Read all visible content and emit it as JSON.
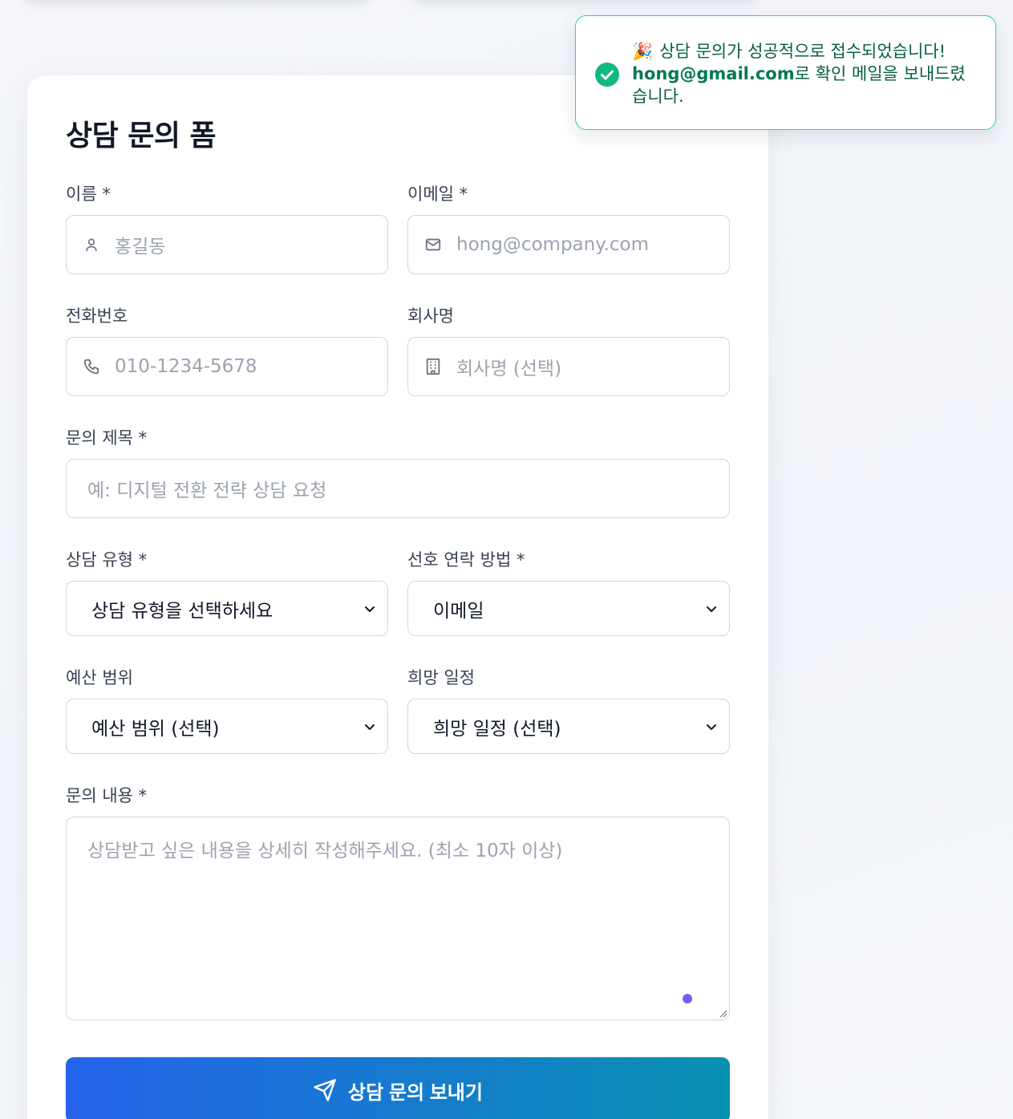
{
  "toast": {
    "emoji": "🎉",
    "line1": "상담 문의가 성공적으로 접수되었습니다!",
    "email": "hong@gmail.com",
    "line2": "로 확인 메일을 보내드렸습니다."
  },
  "form": {
    "title": "상담 문의 폼",
    "name": {
      "label": "이름 *",
      "placeholder": "홍길동",
      "icon": "user-icon"
    },
    "email": {
      "label": "이메일 *",
      "placeholder": "hong@company.com",
      "icon": "mail-icon"
    },
    "phone": {
      "label": "전화번호",
      "placeholder": "010-1234-5678",
      "icon": "phone-icon"
    },
    "company": {
      "label": "회사명",
      "placeholder": "회사명 (선택)",
      "icon": "building-icon"
    },
    "subject": {
      "label": "문의 제목 *",
      "placeholder": "예: 디지털 전환 전략 상담 요청"
    },
    "consult_type": {
      "label": "상담 유형 *",
      "value": "상담 유형을 선택하세요"
    },
    "contact_method": {
      "label": "선호 연락 방법 *",
      "value": "이메일"
    },
    "budget": {
      "label": "예산 범위",
      "value": "예산 범위 (선택)"
    },
    "schedule": {
      "label": "희망 일정",
      "value": "희망 일정 (선택)"
    },
    "message": {
      "label": "문의 내용 *",
      "placeholder": "상담받고 싶은 내용을 상세히 작성해주세요. (최소 10자 이상)"
    },
    "submit_label": "상담 문의 보내기"
  },
  "colors": {
    "accent_start": "#2563eb",
    "accent_end": "#0891b2",
    "success": "#10b981"
  }
}
